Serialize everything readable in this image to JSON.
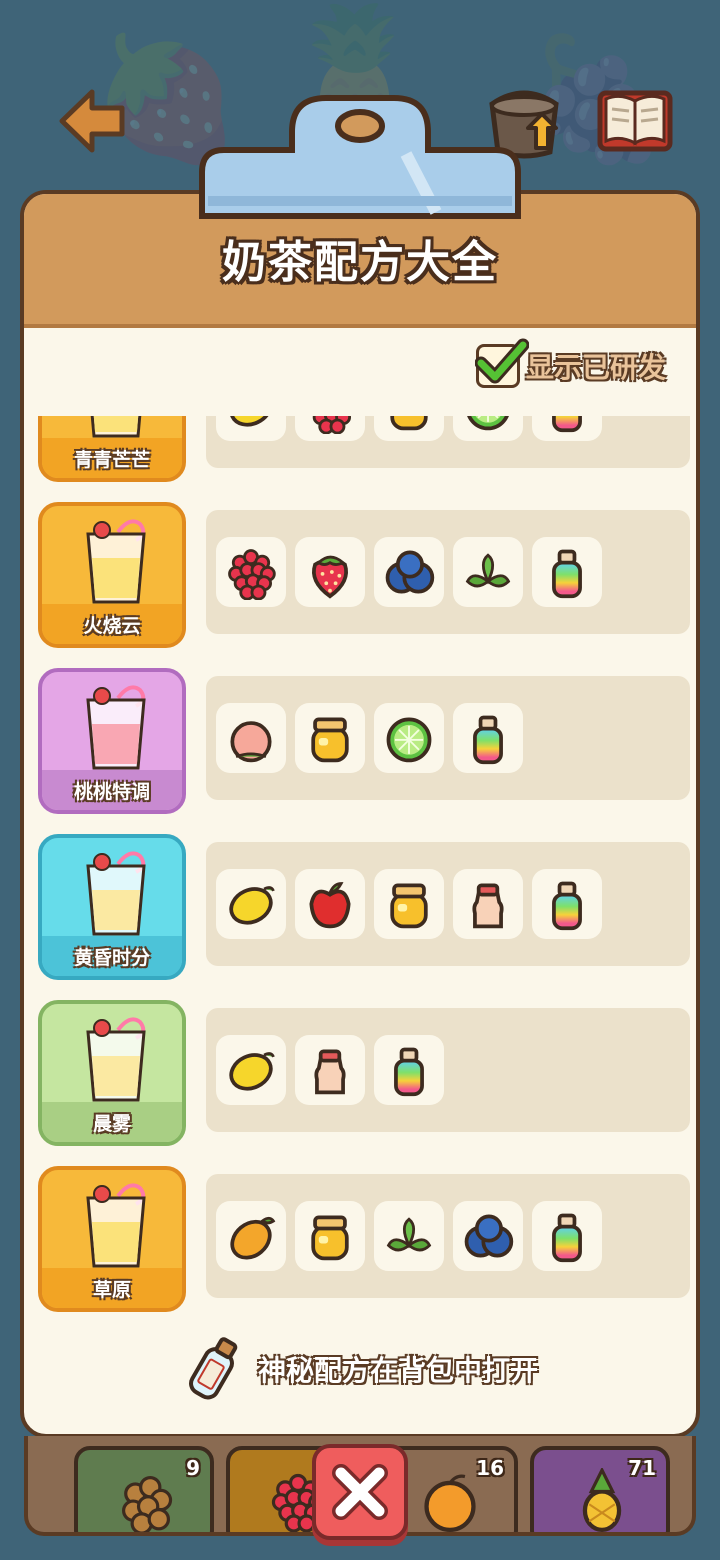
{
  "header": {
    "title": "奶茶配方大全",
    "show_researched_label": "显示已研发",
    "show_researched_checked": true
  },
  "recipes": [
    {
      "name": "青青芒芒",
      "color": "#f7b93a",
      "border": "#e08a1e",
      "bar": "#f2a424",
      "ingredients": [
        "lemon",
        "raspberry",
        "honey-jar",
        "lime",
        "rainbow-bottle"
      ]
    },
    {
      "name": "火烧云",
      "color": "#f7b93a",
      "border": "#e08a1e",
      "bar": "#f2a424",
      "ingredients": [
        "raspberry",
        "strawberry",
        "blueberry",
        "mint",
        "rainbow-bottle"
      ]
    },
    {
      "name": "桃桃特调",
      "color": "#e4a6e6",
      "border": "#b16cbf",
      "bar": "#c88ad0",
      "ingredients": [
        "peach",
        "honey-jar",
        "lime",
        "rainbow-bottle"
      ]
    },
    {
      "name": "黄昏时分",
      "color": "#66dcea",
      "border": "#37a9c1",
      "bar": "#4cc3d8",
      "ingredients": [
        "lemon",
        "apple",
        "honey-jar",
        "yakult",
        "rainbow-bottle"
      ]
    },
    {
      "name": "晨雾",
      "color": "#c5e6a0",
      "border": "#84b462",
      "bar": "#a9cf84",
      "ingredients": [
        "lemon",
        "yakult",
        "rainbow-bottle"
      ]
    },
    {
      "name": "草原",
      "color": "#f7b93a",
      "border": "#e08a1e",
      "bar": "#f2a424",
      "ingredients": [
        "mango",
        "honey-jar",
        "mint",
        "blueberry",
        "rainbow-bottle"
      ]
    }
  ],
  "footer": {
    "note": "神秘配方在背包中打开"
  },
  "tray": {
    "slots": [
      {
        "icon": "longan",
        "count": "9",
        "color": "#5f7c4f"
      },
      {
        "icon": "raspberry",
        "count": "",
        "color": "#b07a1e"
      },
      {
        "icon": "orange",
        "count": "16",
        "color": "#8a6b52"
      },
      {
        "icon": "pineapple",
        "count": "71",
        "color": "#7b4f8e"
      }
    ]
  },
  "icons": {
    "back": "back-arrow-icon",
    "shop": "bucket-upgrade-icon",
    "book": "recipe-book-icon",
    "close": "close-icon"
  }
}
